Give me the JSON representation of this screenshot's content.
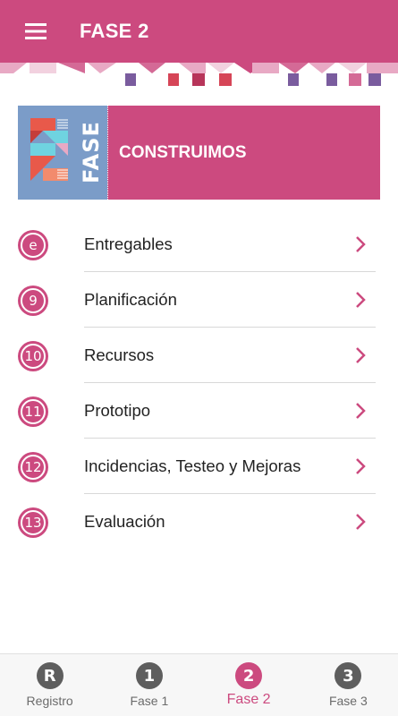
{
  "appbar": {
    "title": "FASE 2",
    "menu_icon": "hamburger-menu-icon",
    "color": "#cc4a7f"
  },
  "banner": {
    "logo_text": "FASE",
    "title": "CONSTRUIMOS",
    "logo_bg": "#7b9cc8"
  },
  "items": [
    {
      "badge": "e",
      "label": "Entregables"
    },
    {
      "badge": "9",
      "label": "Planificación"
    },
    {
      "badge": "10",
      "label": "Recursos"
    },
    {
      "badge": "11",
      "label": "Prototipo"
    },
    {
      "badge": "12",
      "label": "Incidencias, Testeo y Mejoras"
    },
    {
      "badge": "13",
      "label": "Evaluación"
    }
  ],
  "bottom_nav": [
    {
      "glyph": "R",
      "label": "Registro",
      "active": false
    },
    {
      "glyph": "1",
      "label": "Fase 1",
      "active": false
    },
    {
      "glyph": "2",
      "label": "Fase 2",
      "active": true
    },
    {
      "glyph": "3",
      "label": "Fase 3",
      "active": false
    }
  ],
  "colors": {
    "accent": "#cc4a7f",
    "inactive": "#5e5e5e",
    "text": "#222222"
  }
}
